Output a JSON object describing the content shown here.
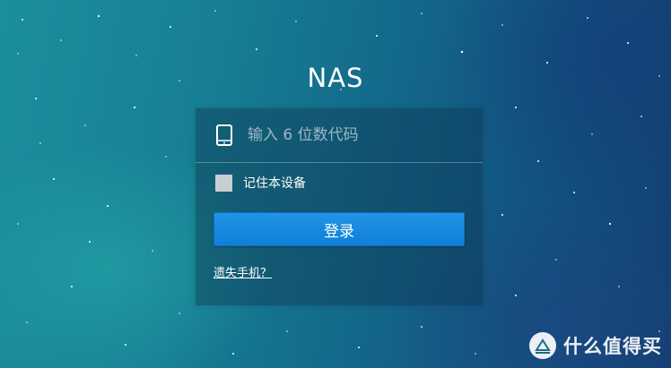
{
  "app": {
    "title": "NAS"
  },
  "form": {
    "code_placeholder": "输入 6 位数代码",
    "code_value": "",
    "remember_label": "记住本设备",
    "remember_checked": false,
    "login_label": "登录",
    "lost_phone_label": "遗失手机？"
  },
  "icons": {
    "device": "phone-icon"
  },
  "watermark": {
    "text": "什么值得买"
  },
  "colors": {
    "button": "#1688e0",
    "checkbox": "#c9ced3",
    "text": "#ffffff"
  }
}
